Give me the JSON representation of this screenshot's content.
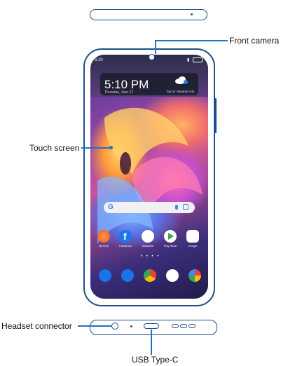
{
  "callouts": {
    "front_camera": "Front camera",
    "touch_screen": "Touch screen",
    "headset_connector": "Headset connector",
    "usb_type_c": "USB Type-C"
  },
  "screen": {
    "status_time": "5:10",
    "clock": "5:10 PM",
    "date": "Thursday, June 27",
    "weather_hint": "Tap for Weather info",
    "search_logo": "G",
    "apps": [
      "MyTime",
      "Facebook",
      "Assistant",
      "Play Store",
      "Google"
    ],
    "page_dots": "• • • •"
  },
  "colors": {
    "outline": "#1d4f8a",
    "leader": "#1f73c1"
  }
}
